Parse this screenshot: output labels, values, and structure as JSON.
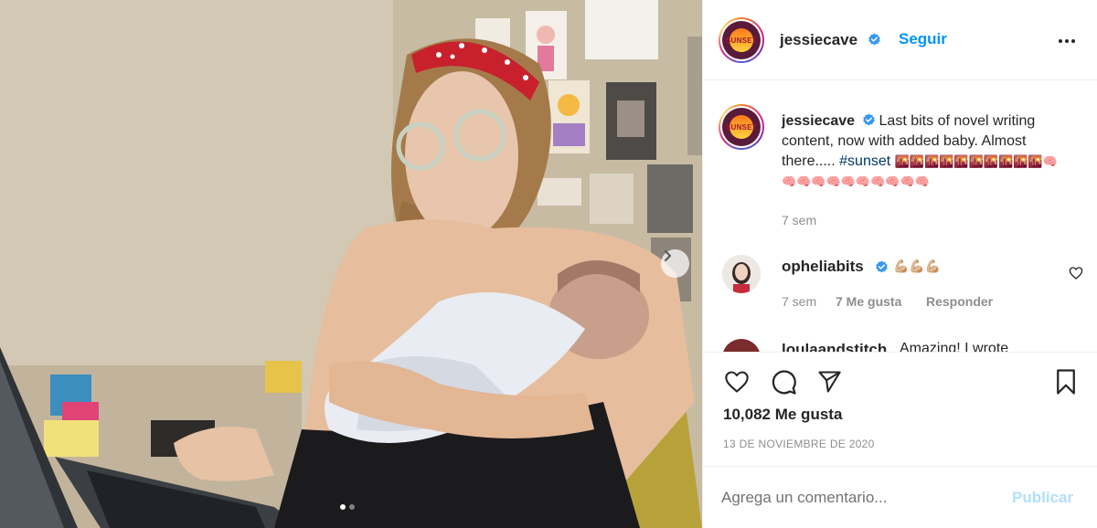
{
  "post": {
    "author": "jessiecave",
    "follow_label": "Seguir",
    "avatar_text": "SUNSET",
    "caption_text": "Last bits of novel writing content, now with added baby. Almost there..... ",
    "caption_hashtag": "#sunset",
    "caption_emoji_line1": "🌇🌇🌇🌇🌇🌇🌇🌇🌇🌇🧠",
    "caption_emoji_line2": "🧠🧠🧠🧠🧠🧠🧠🧠🧠🧠",
    "caption_time": "7 sem",
    "likes": "10,082 Me gusta",
    "date": "13 DE NOVIEMBRE DE 2020"
  },
  "comments": [
    {
      "username": "opheliabits",
      "text": "💪🏼💪🏼💪🏼",
      "time": "7 sem",
      "likes": "7 Me gusta",
      "reply_label": "Responder"
    },
    {
      "username": "loulaandstitch",
      "text": "Amazing! I wrote"
    }
  ],
  "comment_box": {
    "placeholder": "Agrega un comentario...",
    "publish_label": "Publicar"
  },
  "carousel": {
    "slides": 2,
    "current": 1
  },
  "colors": {
    "link_blue": "#0095f6",
    "hashtag": "#00376b",
    "muted": "#8e8e8e",
    "publish_disabled": "#b2dffc",
    "verified": "#3897f0"
  }
}
